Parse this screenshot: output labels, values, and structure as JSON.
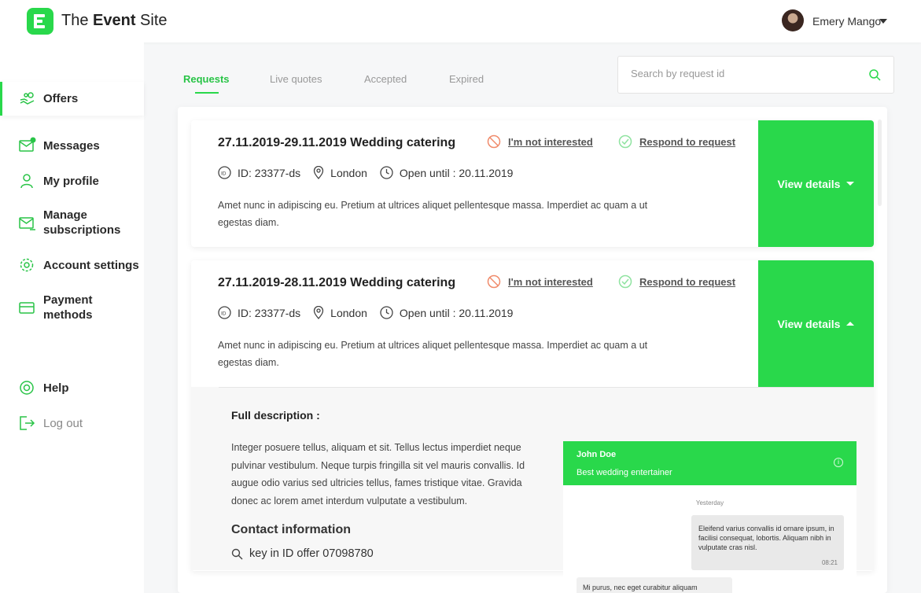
{
  "header": {
    "brand_prefix": "The ",
    "brand_bold": "Event",
    "brand_suffix": " Site",
    "user_name": "Emery Mango"
  },
  "sidebar": {
    "items": [
      {
        "label": "Offers",
        "icon": "offers-hand-icon"
      },
      {
        "label": "Messages",
        "icon": "envelope-icon",
        "badge": "1"
      },
      {
        "label": "My profile",
        "icon": "user-icon"
      },
      {
        "label": "Manage subscriptions",
        "icon": "mail-subscription-icon"
      },
      {
        "label": "Account settings",
        "icon": "gear-icon"
      },
      {
        "label": "Payment methods",
        "icon": "credit-card-icon"
      },
      {
        "label": "Help",
        "icon": "lifebuoy-icon"
      },
      {
        "label": "Log out",
        "icon": "logout-icon"
      }
    ]
  },
  "tabs": [
    {
      "label": "Requests",
      "active": true
    },
    {
      "label": "Live quotes",
      "active": false
    },
    {
      "label": "Accepted",
      "active": false
    },
    {
      "label": "Expired",
      "active": false
    }
  ],
  "search": {
    "placeholder": "Search by request id"
  },
  "requests": [
    {
      "title": "27.11.2019-29.11.2019 Wedding catering",
      "not_interested": "I'm not interested",
      "respond": "Respond to request",
      "id": "ID: 23377-ds",
      "location": "London",
      "open_until": "Open until : 20.11.2019",
      "description_line1": "Amet nunc in adipiscing eu. Pretium at ultrices aliquet pellentesque massa. Imperdiet ac quam a ut",
      "description_line2": "egestas diam.",
      "view_details": "View details",
      "expanded": false
    },
    {
      "title": "27.11.2019-28.11.2019 Wedding catering",
      "not_interested": "I'm not interested",
      "respond": "Respond to request",
      "id": "ID: 23377-ds",
      "location": "London",
      "open_until": "Open until : 20.11.2019",
      "description_line1": "Amet nunc in adipiscing eu. Pretium at ultrices aliquet pellentesque massa. Imperdiet ac quam a ut",
      "description_line2": "egestas diam.",
      "view_details": "View details",
      "expanded": true
    }
  ],
  "details": {
    "full_description_title": "Full description :",
    "full_description_lines": [
      "Integer posuere tellus, aliquam et sit. Tellus lectus imperdiet neque",
      "pulvinar vestibulum. Neque turpis fringilla sit vel mauris convallis. Id",
      "augue odio varius sed ultricies tellus, fames tristique vitae. Gravida",
      "donec ac lorem amet interdum vulputate a vestibulum."
    ],
    "contact_title": "Contact information",
    "contact_line": "key in ID offer 07098780"
  },
  "chat": {
    "name": "John Doe",
    "subtitle": "Best wedding entertainer",
    "day": "Yesterday",
    "message_right": "Eleifend varius convallis id ornare ipsum, in facilisi consequat, lobortis. Aliquam nibh in vulputate cras nisl.",
    "message_right_time": "08:21",
    "message_left": "Mi purus, nec eget curabitur aliquam"
  },
  "colors": {
    "accent": "#29d84b",
    "background": "#f6f7f8"
  }
}
